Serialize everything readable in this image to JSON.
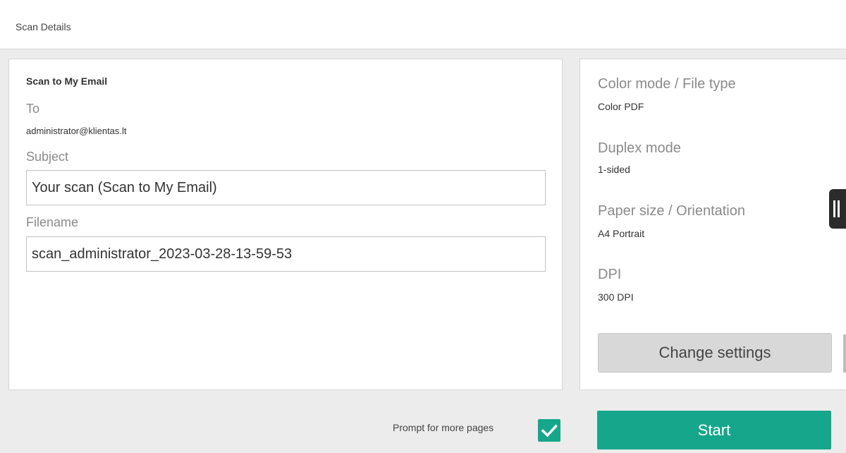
{
  "header": {
    "title": "Scan Details"
  },
  "scan_form": {
    "section_title": "Scan to My Email",
    "to_label": "To",
    "to_value": "administrator@klientas.lt",
    "subject_label": "Subject",
    "subject_value": "Your scan (Scan to My Email)",
    "filename_label": "Filename",
    "filename_value": "scan_administrator_2023-03-28-13-59-53"
  },
  "settings": {
    "color_label": "Color mode / File type",
    "color_value": "Color PDF",
    "duplex_label": "Duplex mode",
    "duplex_value": "1-sided",
    "paper_label": "Paper size / Orientation",
    "paper_value": "A4 Portrait",
    "dpi_label": "DPI",
    "dpi_value": "300 DPI",
    "change_button": "Change settings"
  },
  "footer": {
    "prompt_label": "Prompt for more pages",
    "prompt_checked": true,
    "start_button": "Start"
  },
  "colors": {
    "accent": "#16a68b",
    "background": "#ececec",
    "panel": "#ffffff"
  },
  "icons": {
    "checkbox": "check-icon",
    "side_handle": "pause-icon"
  }
}
